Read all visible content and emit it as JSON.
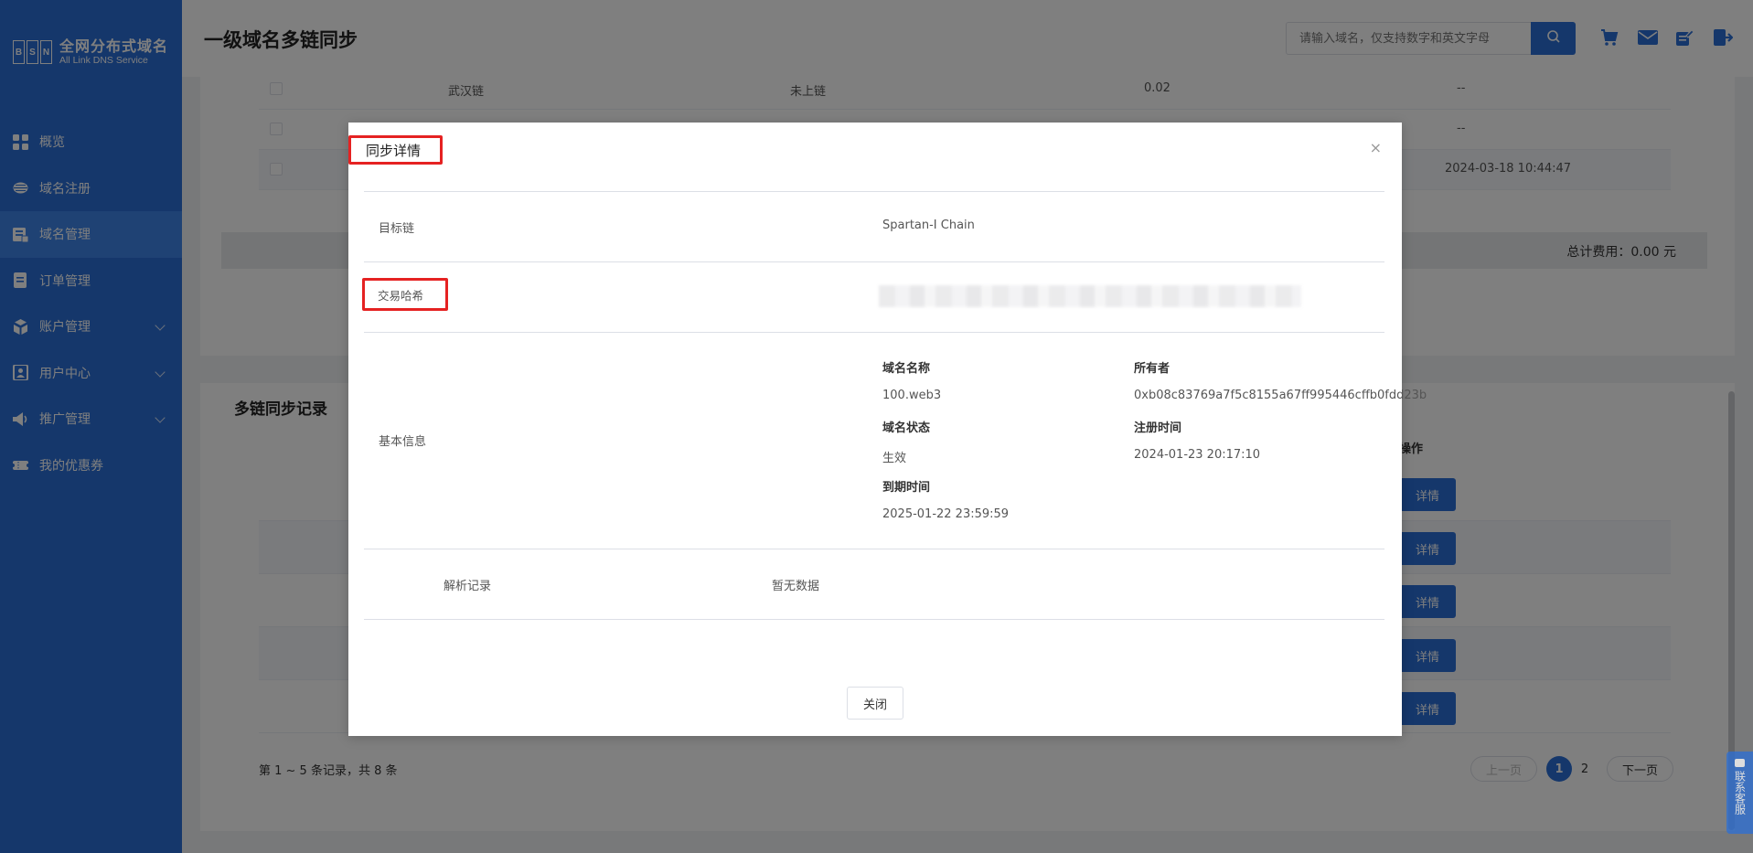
{
  "sidebar": {
    "logo_letters": [
      "B",
      "S",
      "N"
    ],
    "logo_cn": "全网分布式域名",
    "logo_en": "All Link DNS Service",
    "items": [
      {
        "label": "概览",
        "icon": "grid-icon"
      },
      {
        "label": "域名注册",
        "icon": "globe-icon"
      },
      {
        "label": "域名管理",
        "icon": "server-icon",
        "active": true
      },
      {
        "label": "订单管理",
        "icon": "document-icon"
      },
      {
        "label": "账户管理",
        "icon": "cubes-icon",
        "expandable": true
      },
      {
        "label": "用户中心",
        "icon": "user-card-icon",
        "expandable": true
      },
      {
        "label": "推广管理",
        "icon": "megaphone-icon",
        "expandable": true
      },
      {
        "label": "我的优惠券",
        "icon": "coupon-icon"
      }
    ]
  },
  "header": {
    "title": "一级域名多链同步",
    "search_placeholder": "请输入域名，仅支持数字和英文字母",
    "icons": [
      "search-icon",
      "cart-icon",
      "mail-icon",
      "edit-icon",
      "logout-icon"
    ]
  },
  "background_table": {
    "rows": [
      {
        "chain": "武汉链",
        "status": "未上链",
        "fee": "0.02",
        "time": "--"
      },
      {
        "chain": "",
        "status": "",
        "fee": "",
        "time": "--"
      },
      {
        "chain": "",
        "status": "",
        "fee": "",
        "time": "2024-03-18 10:44:47"
      }
    ],
    "total": "总计费用：0.00 元"
  },
  "records": {
    "title": "多链同步记录",
    "op_header": "操作",
    "detail_label": "详情",
    "count_text": "第 1 ~ 5 条记录，共 8 条",
    "pager": {
      "prev": "上一页",
      "pages": [
        "1",
        "2"
      ],
      "active": "1",
      "next": "下一页"
    }
  },
  "service": {
    "label": "联系客服"
  },
  "modal": {
    "title": "同步详情",
    "close_symbol": "×",
    "target_chain_label": "目标链",
    "target_chain_value": "Spartan-I Chain",
    "tx_hash_label": "交易哈希",
    "basic_info_label": "基本信息",
    "basic": {
      "name_label": "域名名称",
      "name_value": "100.web3",
      "owner_label": "所有者",
      "owner_value": "0xb08c83769a7f5c8155a67ff995446cffb0fdd23b",
      "status_label": "域名状态",
      "status_value": "生效",
      "reg_time_label": "注册时间",
      "reg_time_value": "2024-01-23 20:17:10",
      "expire_label": "到期时间",
      "expire_value": "2025-01-22 23:59:59"
    },
    "resolve_label": "解析记录",
    "resolve_value": "暂无数据",
    "close_button": "关闭"
  },
  "colors": {
    "primary": "#2b6fd6",
    "highlight": "#e52222"
  }
}
